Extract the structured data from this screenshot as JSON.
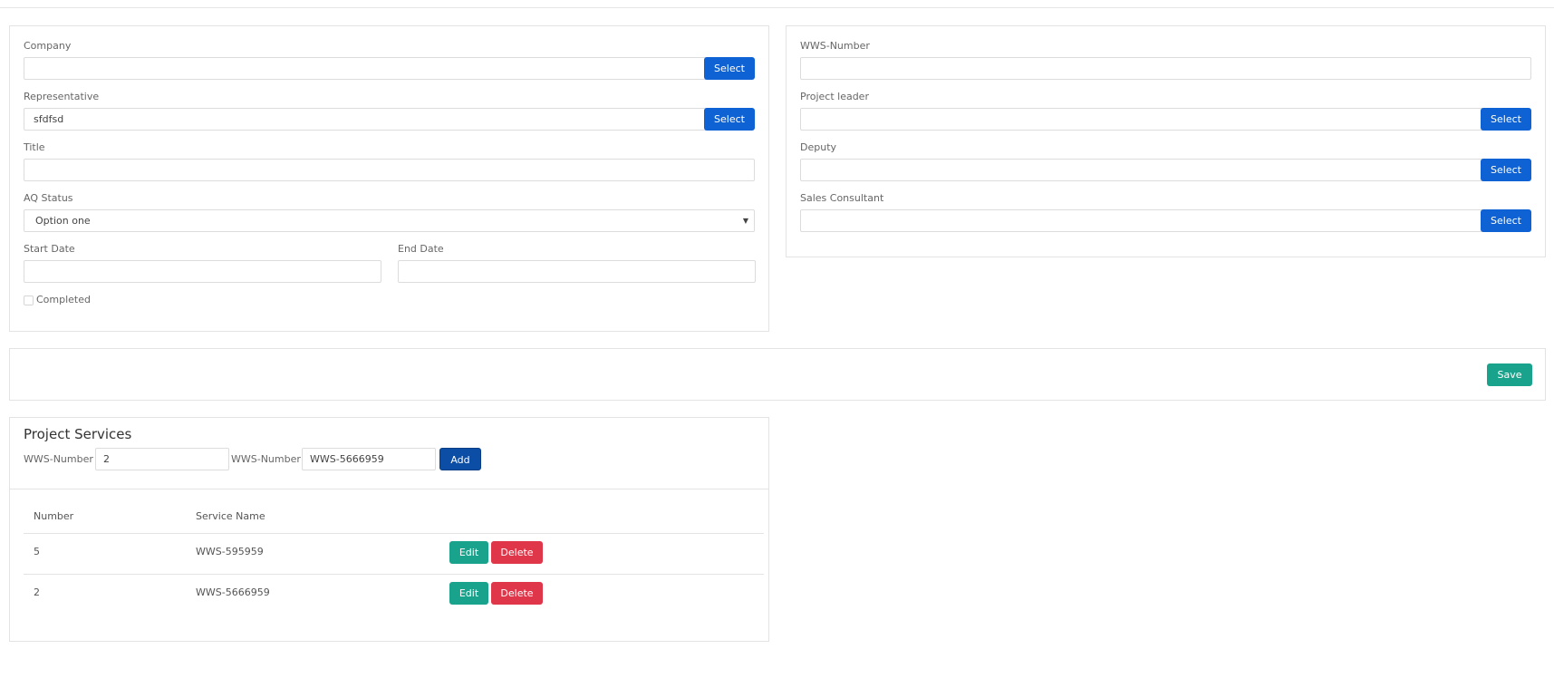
{
  "left_form": {
    "company_label": "Company",
    "company_value": "",
    "company_button": "Select",
    "representative_label": "Representative",
    "representative_value": "sfdfsd",
    "representative_button": "Select",
    "title_label": "Title",
    "title_value": "",
    "aq_status_label": "AQ Status",
    "aq_status_value": "Option one",
    "start_date_label": "Start Date",
    "start_date_value": "",
    "end_date_label": "End Date",
    "end_date_value": "",
    "completed_label": "Completed"
  },
  "right_form": {
    "wws_number_label": "WWS-Number",
    "wws_number_value": "",
    "project_leader_label": "Project leader",
    "project_leader_value": "",
    "project_leader_button": "Select",
    "deputy_label": "Deputy",
    "deputy_value": "",
    "deputy_button": "Select",
    "sales_consultant_label": "Sales Consultant",
    "sales_consultant_value": "",
    "sales_consultant_button": "Select"
  },
  "save_bar": {
    "save_label": "Save"
  },
  "project_services": {
    "title": "Project Services",
    "number_label": "WWS-Number",
    "number_value": "2",
    "wws_label": "WWS-Number",
    "wws_value": "WWS-5666959",
    "add_label": "Add",
    "columns": [
      "Number",
      "Service Name"
    ],
    "rows": [
      {
        "number": "5",
        "service_name": "WWS-595959",
        "edit": "Edit",
        "delete": "Delete"
      },
      {
        "number": "2",
        "service_name": "WWS-5666959",
        "edit": "Edit",
        "delete": "Delete"
      }
    ]
  }
}
